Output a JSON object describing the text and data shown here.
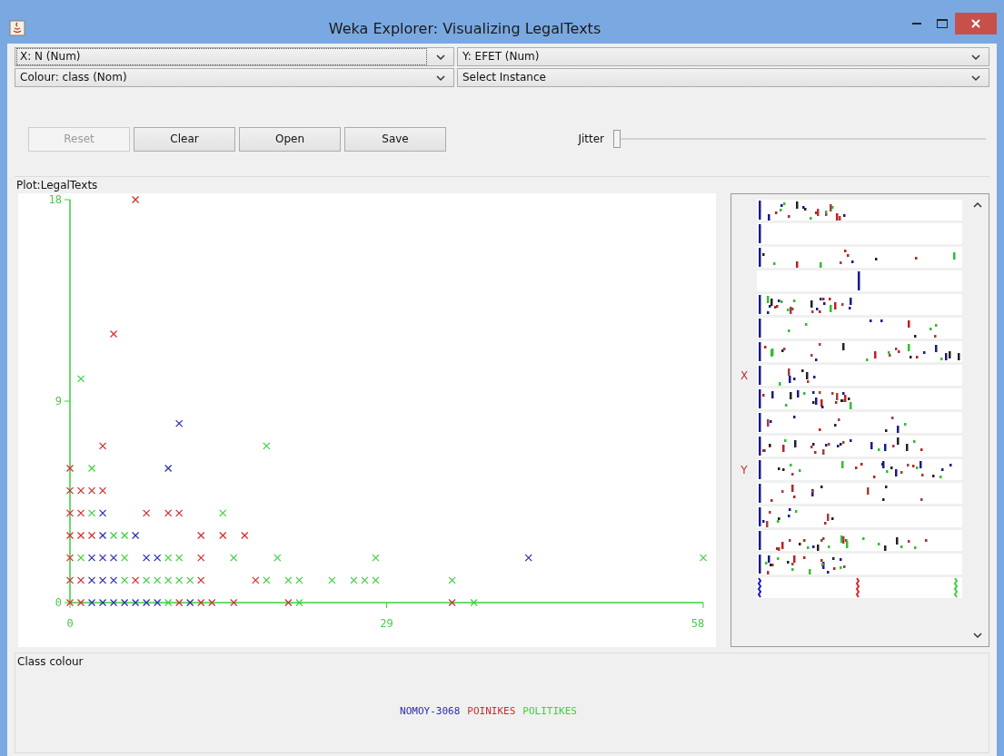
{
  "window": {
    "title": "Weka Explorer: Visualizing LegalTexts"
  },
  "selectors": [
    {
      "label": "X: N (Num)",
      "focused": true
    },
    {
      "label": "Y: EFET (Num)",
      "focused": false
    },
    {
      "label": "Colour: class (Nom)",
      "focused": false
    },
    {
      "label": "Select Instance",
      "focused": false
    }
  ],
  "buttons": [
    {
      "label": "Reset",
      "disabled": true
    },
    {
      "label": "Clear",
      "disabled": false
    },
    {
      "label": "Open",
      "disabled": false
    },
    {
      "label": "Save",
      "disabled": false
    }
  ],
  "jitter": {
    "label": "Jitter",
    "level": 0
  },
  "plot": {
    "title": "Plot:LegalTexts",
    "chart_data": {
      "type": "scatter",
      "xlim": [
        0,
        58
      ],
      "ylim": [
        0,
        18
      ],
      "xticks": [
        {
          "value": 0,
          "label": "0"
        },
        {
          "value": 29,
          "label": "29"
        },
        {
          "value": 58,
          "label": "58"
        }
      ],
      "yticks": [
        {
          "value": 0,
          "label": "0"
        },
        {
          "value": 9,
          "label": "9"
        },
        {
          "value": 18,
          "label": "18"
        }
      ],
      "series": [
        {
          "color": "#2a2ab4",
          "x": [
            10,
            9,
            3,
            3,
            6,
            2,
            3,
            4,
            7,
            8,
            42,
            2,
            3,
            4,
            2,
            3,
            4,
            5,
            6,
            7,
            8,
            11
          ],
          "values": [
            8,
            6,
            3,
            4,
            3,
            2,
            2,
            2,
            2,
            2,
            2,
            1,
            1,
            1,
            0,
            0,
            0,
            0,
            0,
            0,
            0,
            0
          ]
        },
        {
          "color": "#d42a2a",
          "x": [
            6,
            4,
            3,
            0,
            0,
            1,
            2,
            3,
            0,
            1,
            7,
            9,
            10,
            0,
            1,
            2,
            12,
            14,
            16,
            0,
            12,
            0,
            1,
            6,
            12,
            17,
            0,
            1,
            10,
            12,
            13,
            15,
            20,
            35
          ],
          "values": [
            18,
            12,
            7,
            6,
            5,
            5,
            5,
            5,
            4,
            4,
            4,
            4,
            4,
            3,
            3,
            3,
            3,
            3,
            3,
            2,
            2,
            1,
            1,
            1,
            1,
            1,
            0,
            0,
            0,
            0,
            0,
            0,
            0,
            0
          ]
        },
        {
          "color": "#3ad23a",
          "x": [
            1,
            18,
            2,
            2,
            14,
            4,
            5,
            1,
            5,
            9,
            10,
            15,
            19,
            28,
            58,
            5,
            7,
            8,
            9,
            10,
            11,
            18,
            20,
            21,
            24,
            26,
            27,
            28,
            35,
            9,
            21,
            37
          ],
          "values": [
            10,
            7,
            6,
            4,
            4,
            3,
            3,
            2,
            2,
            2,
            2,
            2,
            2,
            2,
            2,
            1,
            1,
            1,
            1,
            1,
            1,
            1,
            1,
            1,
            1,
            1,
            1,
            1,
            1,
            0,
            0,
            0
          ]
        }
      ]
    }
  },
  "attribute_rows": [
    {
      "kind": "plain"
    },
    {
      "kind": "plain"
    },
    {
      "kind": "plain"
    },
    {
      "kind": "plain"
    },
    {
      "kind": "plain"
    },
    {
      "kind": "plain"
    },
    {
      "kind": "plain"
    },
    {
      "kind": "marked",
      "axis_label": "X"
    },
    {
      "kind": "plain"
    },
    {
      "kind": "plain"
    },
    {
      "kind": "plain"
    },
    {
      "kind": "marked",
      "axis_label": "Y"
    },
    {
      "kind": "plain"
    },
    {
      "kind": "plain"
    },
    {
      "kind": "plain"
    },
    {
      "kind": "plain"
    }
  ],
  "class_colour": {
    "title": "Class colour",
    "items": [
      {
        "label": "NOMOY-3068",
        "color": "#2a2ab4"
      },
      {
        "label": "POINIKES",
        "color": "#d42a2a"
      },
      {
        "label": "POLITIKES",
        "color": "#3ad23a"
      }
    ]
  }
}
